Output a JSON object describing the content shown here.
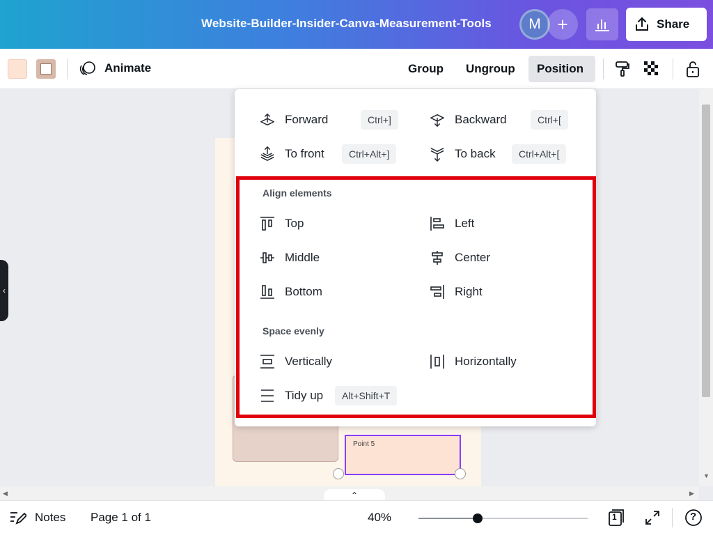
{
  "header": {
    "title": "Website-Builder-Insider-Canva-Measurement-Tools",
    "avatar_initial": "M",
    "add_symbol": "+",
    "share_label": "Share"
  },
  "toolbar": {
    "animate_label": "Animate",
    "group_label": "Group",
    "ungroup_label": "Ungroup",
    "position_label": "Position"
  },
  "canvas": {
    "point_label": "Point 5"
  },
  "position_menu": {
    "layer_items": [
      {
        "label": "Forward",
        "shortcut": "Ctrl+]",
        "icon": "forward-icon"
      },
      {
        "label": "Backward",
        "shortcut": "Ctrl+[",
        "icon": "backward-icon"
      },
      {
        "label": "To front",
        "shortcut": "Ctrl+Alt+]",
        "icon": "to-front-icon"
      },
      {
        "label": "To back",
        "shortcut": "Ctrl+Alt+[",
        "icon": "to-back-icon"
      }
    ],
    "align_title": "Align elements",
    "align_items": [
      {
        "label": "Top",
        "icon": "align-top-icon"
      },
      {
        "label": "Left",
        "icon": "align-left-icon"
      },
      {
        "label": "Middle",
        "icon": "align-middle-icon"
      },
      {
        "label": "Center",
        "icon": "align-center-icon"
      },
      {
        "label": "Bottom",
        "icon": "align-bottom-icon"
      },
      {
        "label": "Right",
        "icon": "align-right-icon"
      }
    ],
    "space_title": "Space evenly",
    "space_items": [
      {
        "label": "Vertically",
        "icon": "space-vertical-icon"
      },
      {
        "label": "Horizontally",
        "icon": "space-horizontal-icon"
      }
    ],
    "tidy": {
      "label": "Tidy up",
      "shortcut": "Alt+Shift+T",
      "icon": "tidy-up-icon"
    },
    "highlight_color": "#e0000b"
  },
  "footer": {
    "notes_label": "Notes",
    "page_info": "Page 1 of 1",
    "zoom": "40%",
    "zoom_level": 0.35,
    "page_count": "1",
    "help_symbol": "?"
  },
  "colors": {
    "accent": "#8b3dff",
    "swatch_1": "#fde3d4",
    "swatch_2": "#d8b8a8"
  }
}
